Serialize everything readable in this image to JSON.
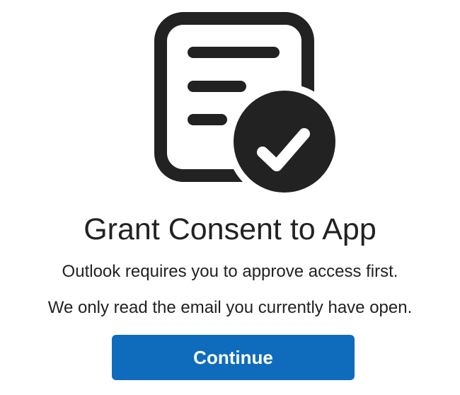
{
  "theme": {
    "accent": "#0f6cbd",
    "icon_color": "#222222",
    "text_color": "#222222",
    "background": "#ffffff"
  },
  "hero": {
    "icon": "document-checkmark-icon"
  },
  "dialog": {
    "title": "Grant Consent to App",
    "message_line1": "Outlook requires you to approve access first.",
    "message_line2": "We only read the email you currently have open.",
    "continue_label": "Continue"
  }
}
